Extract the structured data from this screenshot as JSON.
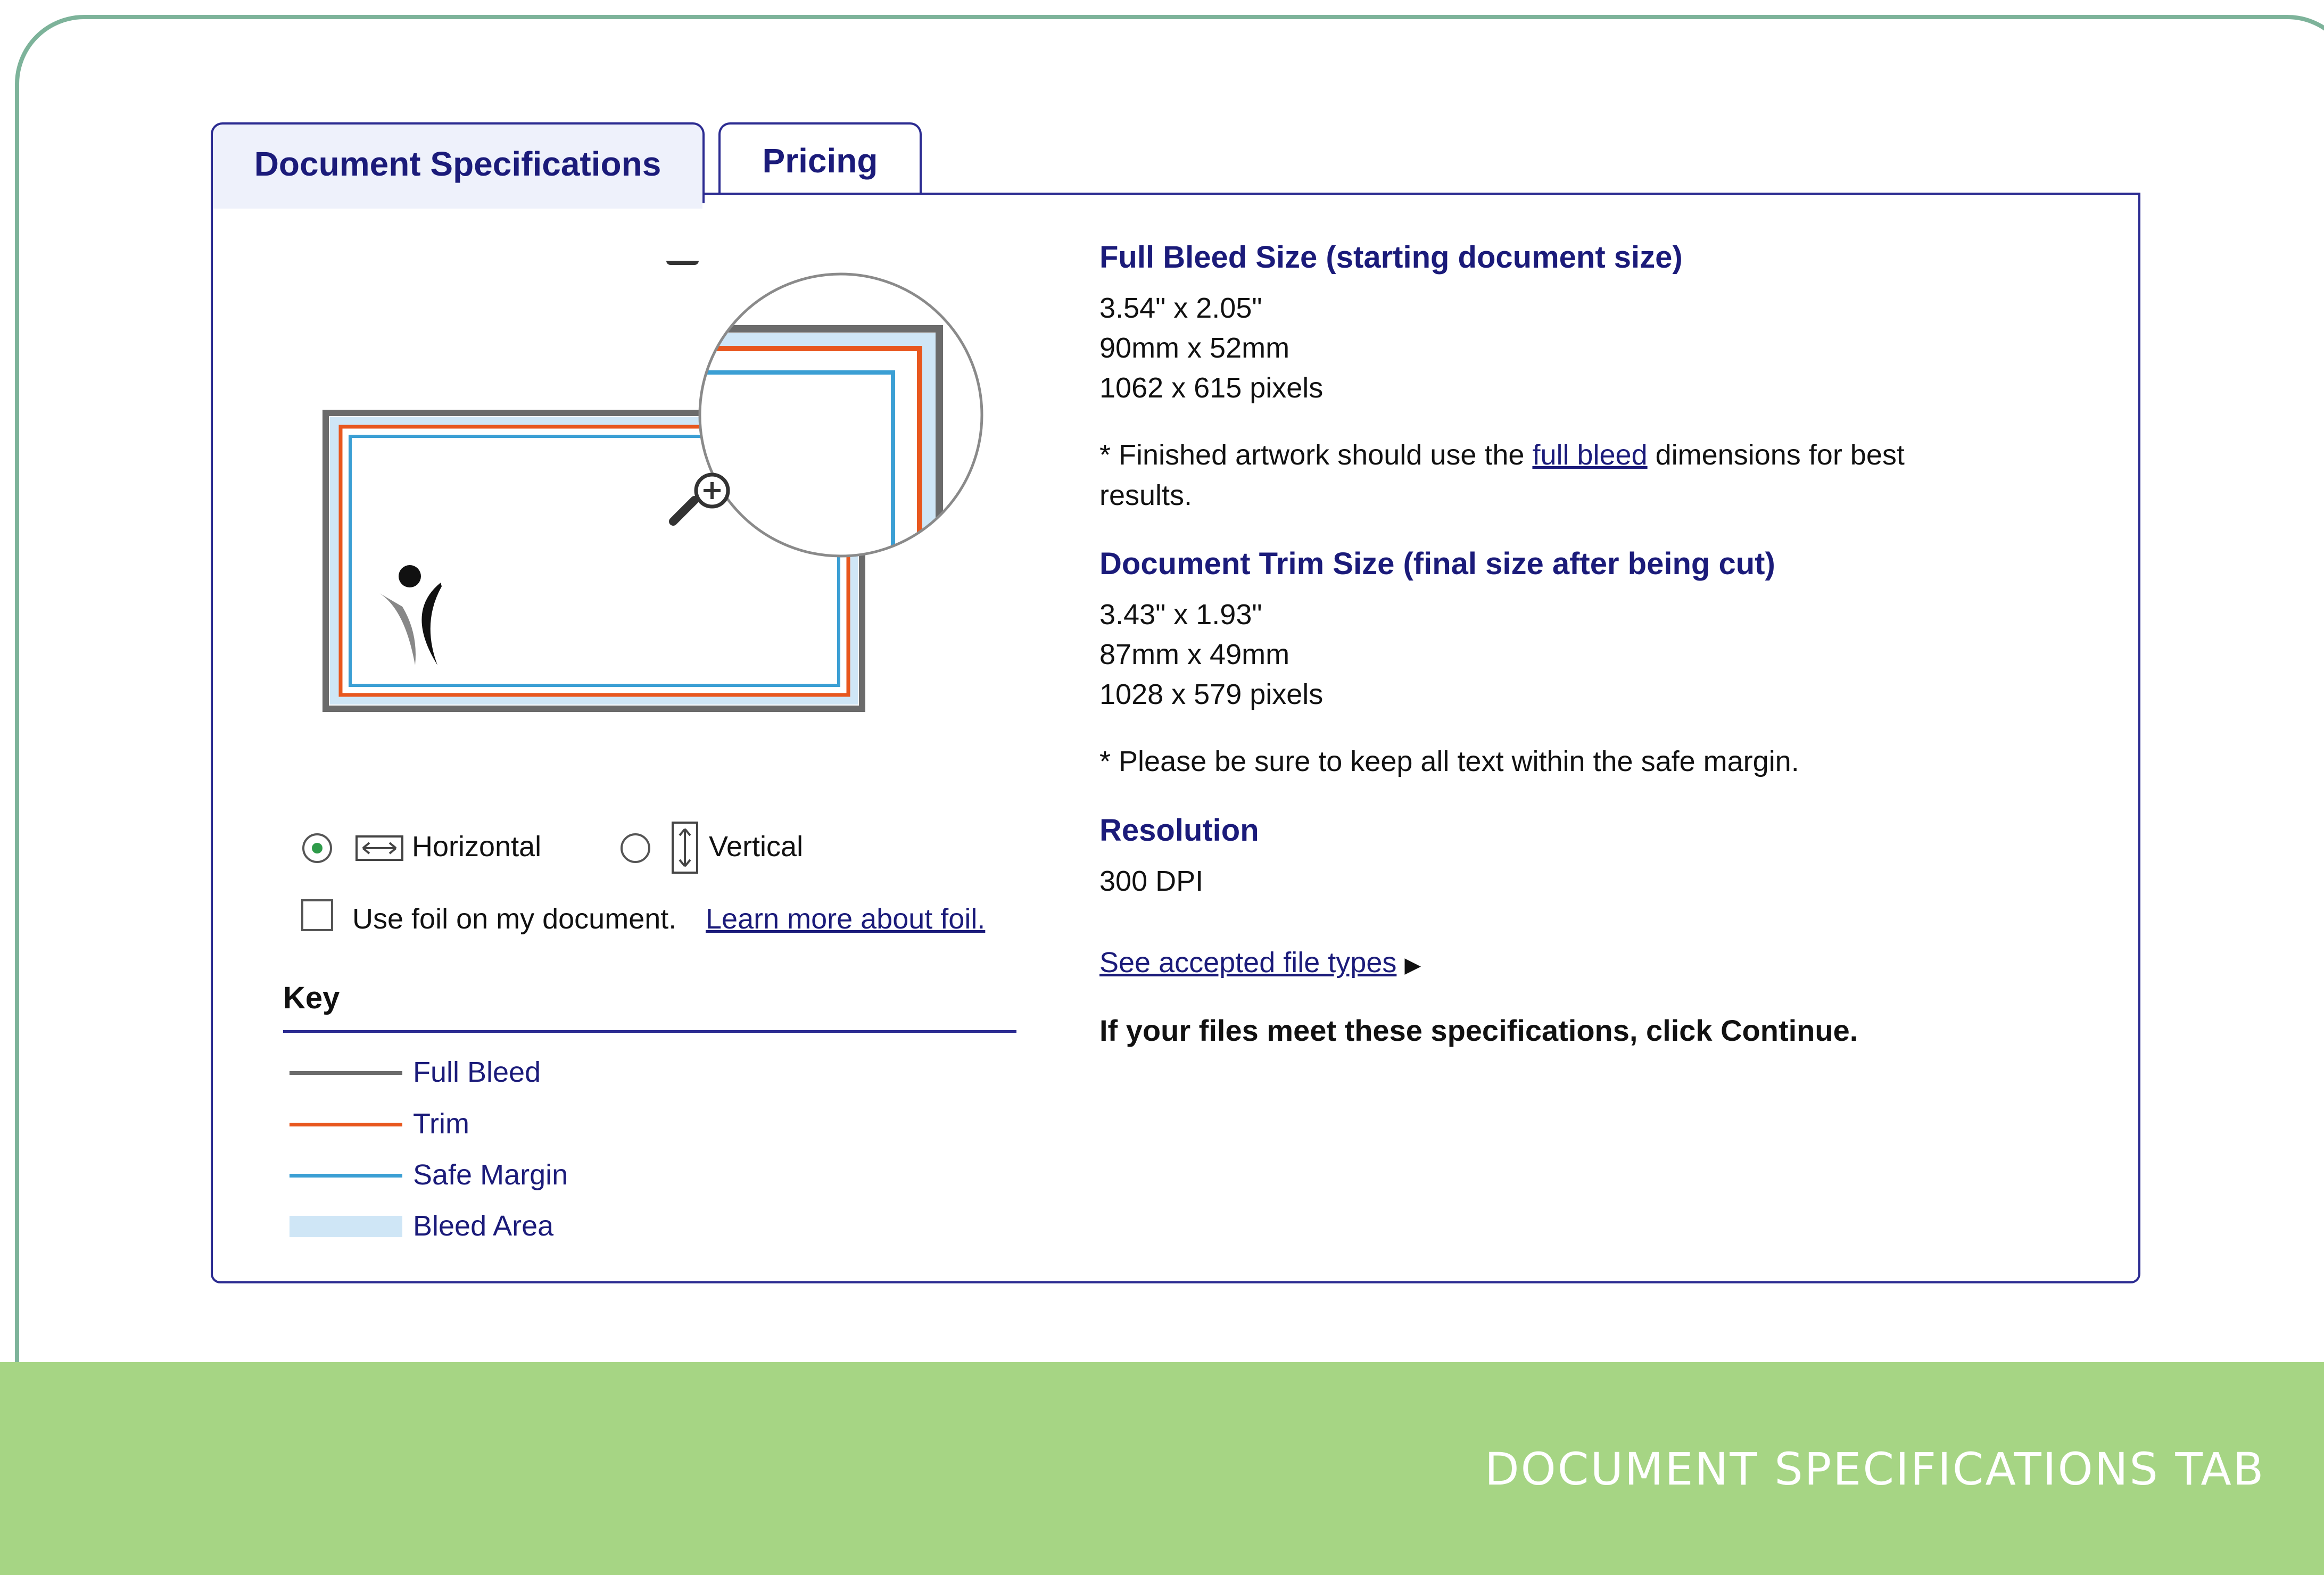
{
  "tabs": [
    {
      "label": "Document Specifications",
      "active": true
    },
    {
      "label": "Pricing",
      "active": false
    }
  ],
  "orientation": {
    "horizontal_label": "Horizontal",
    "vertical_label": "Vertical",
    "selected": "Horizontal"
  },
  "foil": {
    "label": "Use foil on my document.",
    "link": "Learn more about foil.",
    "checked": false
  },
  "key": {
    "title": "Key",
    "items": [
      {
        "label": "Full Bleed",
        "color": "#6b6b6b"
      },
      {
        "label": "Trim",
        "color": "#e8571e"
      },
      {
        "label": "Safe Margin",
        "color": "#3b9fd4"
      },
      {
        "label": "Bleed Area",
        "color": "#cfe6f6"
      }
    ]
  },
  "specs": {
    "full_bleed": {
      "title": "Full Bleed Size (starting document size)",
      "inches": "3.54\" x 2.05\"",
      "mm": "90mm x 52mm",
      "pixels": "1062 x 615 pixels",
      "note_prefix": "* Finished artwork should use the",
      "note_link": "full bleed",
      "note_suffix": "dimensions for best",
      "note_line2": "results."
    },
    "trim": {
      "title": "Document Trim Size (final size after being cut)",
      "inches": "3.43\" x 1.93\"",
      "mm": "87mm x 49mm",
      "pixels": "1028 x 579 pixels",
      "note": "* Please be sure to keep all text within the safe margin."
    },
    "resolution": {
      "title": "Resolution",
      "value": "300 DPI"
    },
    "file_types_link": "See accepted file types",
    "continue_note": "If your files meet these specifications, click Continue."
  },
  "footer": {
    "caption": "DOCUMENT SPECIFICATIONS TAB",
    "color": "#a6d584"
  }
}
